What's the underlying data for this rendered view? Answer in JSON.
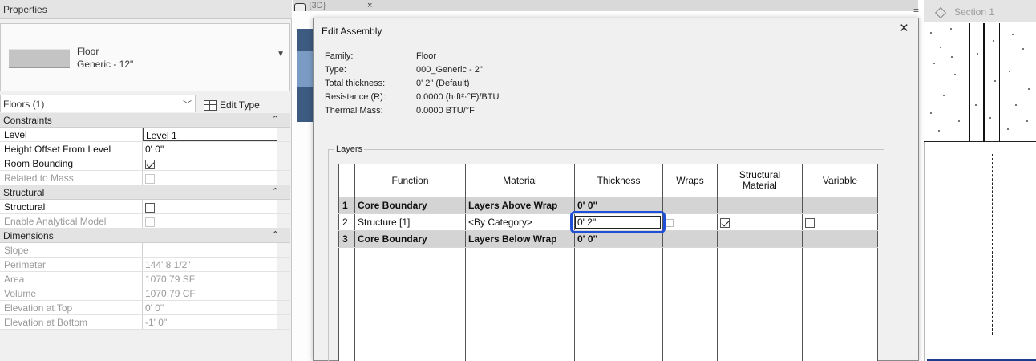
{
  "properties": {
    "title": "Properties",
    "type_selector": {
      "family": "Floor",
      "type": "Generic - 12\""
    },
    "instance_dropdown": "Floors (1)",
    "edit_type_label": "Edit Type",
    "sections": [
      {
        "name": "Constraints",
        "rows": [
          {
            "label": "Level",
            "value": "Level 1"
          },
          {
            "label": "Height Offset From Level",
            "value": "0' 0\""
          },
          {
            "label": "Room Bounding",
            "checkbox": true
          },
          {
            "label": "Related to Mass",
            "checkbox": false
          }
        ]
      },
      {
        "name": "Structural",
        "rows": [
          {
            "label": "Structural",
            "checkbox": false
          },
          {
            "label": "Enable Analytical Model",
            "checkbox": false
          }
        ]
      },
      {
        "name": "Dimensions",
        "rows": [
          {
            "label": "Slope",
            "value": ""
          },
          {
            "label": "Perimeter",
            "value": "144'  8 1/2\""
          },
          {
            "label": "Area",
            "value": "1070.79 SF"
          },
          {
            "label": "Volume",
            "value": "1070.79 CF"
          },
          {
            "label": "Elevation at Top",
            "value": "0'  0\""
          },
          {
            "label": "Elevation at Bottom",
            "value": "-1'  0\""
          }
        ]
      }
    ]
  },
  "view_tab": {
    "title": "{3D}",
    "close": "×"
  },
  "section_view": {
    "title": "Section 1",
    "minimize": "="
  },
  "dialog": {
    "title": "Edit Assembly",
    "close": "×",
    "info": [
      {
        "key": "Family:",
        "value": "Floor"
      },
      {
        "key": "Type:",
        "value": "000_Generic - 2\""
      },
      {
        "key": "Total thickness:",
        "value": "0'  2\" (Default)"
      },
      {
        "key": "Resistance (R):",
        "value": "0.0000 (h·ft²·°F)/BTU"
      },
      {
        "key": "Thermal Mass:",
        "value": "0.0000 BTU/°F"
      }
    ],
    "layers_label": "Layers",
    "columns": {
      "function": "Function",
      "material": "Material",
      "thickness": "Thickness",
      "wraps": "Wraps",
      "structural_material_line1": "Structural",
      "structural_material_line2": "Material",
      "variable": "Variable"
    },
    "rows": [
      {
        "num": "1",
        "function": "Core Boundary",
        "material": "Layers Above Wrap",
        "thickness": "0'  0\""
      },
      {
        "num": "2",
        "function": "Structure [1]",
        "material": "<By Category>",
        "thickness": "0'  2\"",
        "structural_material": true,
        "variable": false
      },
      {
        "num": "3",
        "function": "Core Boundary",
        "material": "Layers Below Wrap",
        "thickness": "0'  0\""
      }
    ]
  }
}
